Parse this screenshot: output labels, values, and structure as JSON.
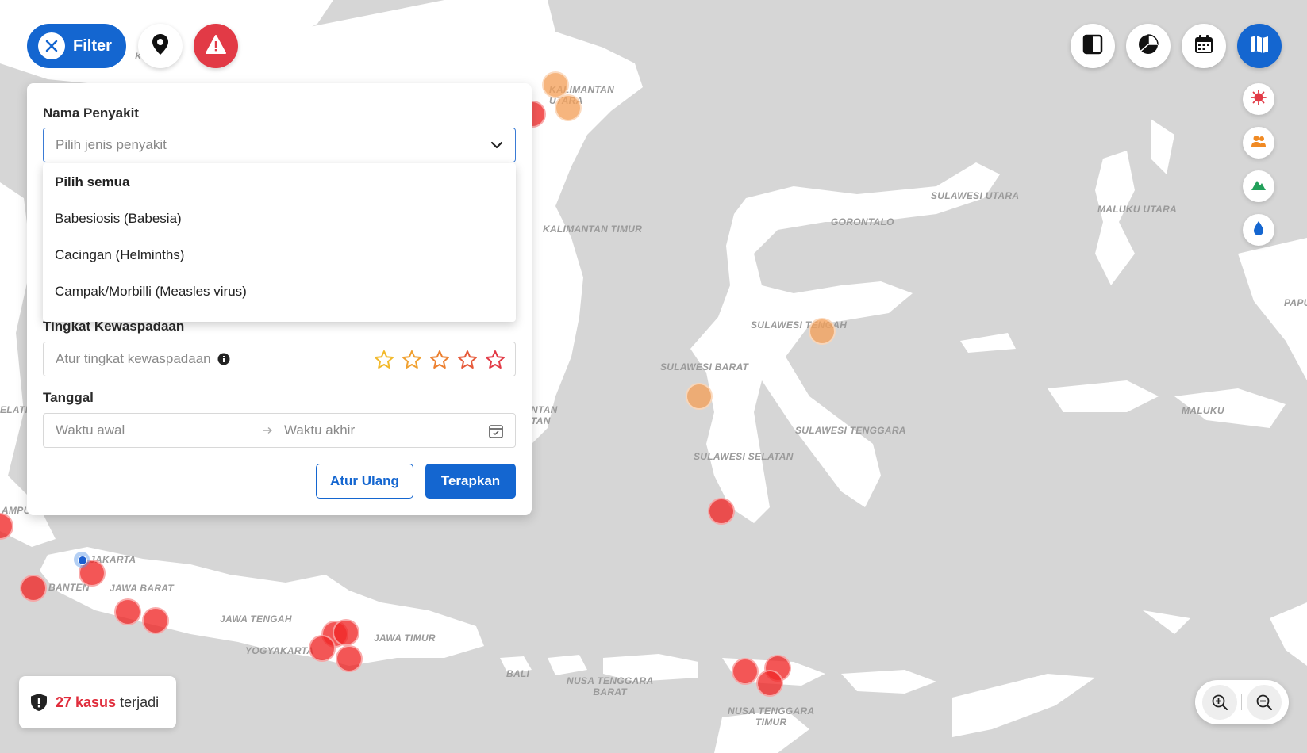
{
  "map": {
    "regions": [
      {
        "id": "kalimantan-utara",
        "text": "KALIMANTAN\nUTARA"
      },
      {
        "id": "kalimantan-timur",
        "text": "KALIMANTAN TIMUR"
      },
      {
        "id": "kalimantan-fragment-top",
        "text": "K      JAN"
      },
      {
        "id": "sulawesi-utara",
        "text": "SULAWESI UTARA"
      },
      {
        "id": "gorontalo",
        "text": "GORONTALO"
      },
      {
        "id": "maluku-utara",
        "text": "MALUKU UTARA"
      },
      {
        "id": "sulawesi-tengah",
        "text": "SULAWESI TENGAH"
      },
      {
        "id": "sulawesi-barat",
        "text": "SULAWESI BARAT"
      },
      {
        "id": "sulawesi-tenggara",
        "text": "SULAWESI TENGGARA"
      },
      {
        "id": "sulawesi-selatan",
        "text": "SULAWESI SELATAN"
      },
      {
        "id": "maluku",
        "text": "MALUKU"
      },
      {
        "id": "papua",
        "text": "PAPU"
      },
      {
        "id": "kalimantan-selatan",
        "text": "NTAN\nTAN"
      },
      {
        "id": "belitung",
        "text": "ELATI"
      },
      {
        "id": "lampung",
        "text": "AMPU"
      },
      {
        "id": "jakarta",
        "text": "JAKARTA"
      },
      {
        "id": "banten",
        "text": "BANTEN"
      },
      {
        "id": "jawa-barat",
        "text": "JAWA BARAT"
      },
      {
        "id": "jawa-tengah",
        "text": "JAWA TENGAH"
      },
      {
        "id": "yogyakarta",
        "text": "YOGYAKARTA"
      },
      {
        "id": "jawa-timur",
        "text": "JAWA TIMUR"
      },
      {
        "id": "bali",
        "text": "BALI"
      },
      {
        "id": "ntb",
        "text": "NUSA TENGGARA\nBARAT"
      },
      {
        "id": "ntt",
        "text": "NUSA TENGGARA\nTIMUR"
      }
    ],
    "marker_colors": {
      "high": "#f02626",
      "medium": "#f4a05a"
    }
  },
  "filter_button": {
    "label": "Filter"
  },
  "filter_panel": {
    "disease": {
      "label": "Nama Penyakit",
      "placeholder": "Pilih jenis penyakit",
      "options": [
        "Pilih semua",
        "Babesiosis (Babesia)",
        "Cacingan (Helminths)",
        "Campak/Morbilli (Measles virus)"
      ]
    },
    "alert_level": {
      "label": "Tingkat Kewaspadaan",
      "placeholder": "Atur tingkat kewaspadaan",
      "star_colors": [
        "#f2b92b",
        "#f0a030",
        "#ec8030",
        "#e65a3a",
        "#e23a46"
      ]
    },
    "date": {
      "label": "Tanggal",
      "start_placeholder": "Waktu awal",
      "end_placeholder": "Waktu akhir"
    },
    "reset_label": "Atur Ulang",
    "apply_label": "Terapkan"
  },
  "case_badge": {
    "count": "27 kasus",
    "suffix": "terjadi"
  },
  "colors": {
    "primary": "#1466d0",
    "danger": "#e23a46",
    "case_count": "#e02d3c"
  }
}
